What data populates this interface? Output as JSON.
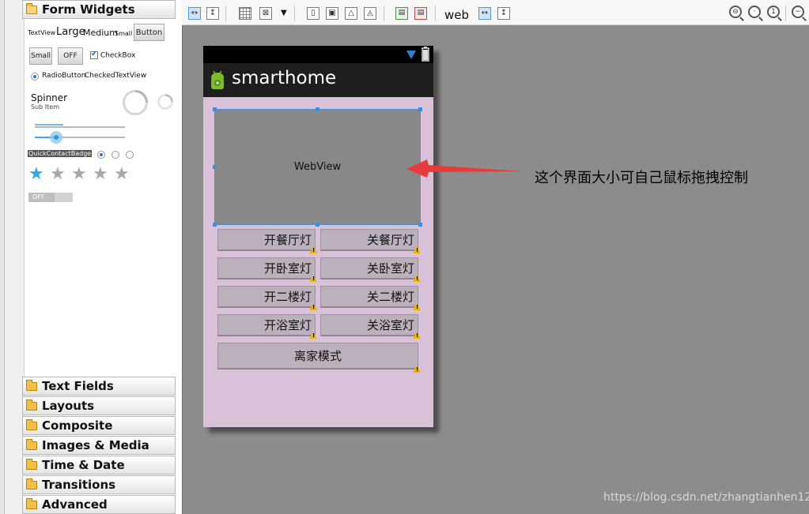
{
  "palette": {
    "form_widgets": "Form Widgets",
    "textview_small_label": "TextView",
    "large_label": "Large",
    "medium_label": "Medium",
    "small_label": "Small",
    "button_label": "Button",
    "small_button_label": "Small",
    "toggle_off_label": "OFF",
    "checkbox_label": "CheckBox",
    "radio_label": "RadioButton",
    "checked_textview_label": "CheckedTextView",
    "spinner_label": "Spinner",
    "sub_item_label": "Sub Item",
    "quick_contact_label": "QuickContactBadge",
    "switch_off_label": "OFF",
    "rating": 1,
    "rating_max": 5,
    "categories": [
      "Text Fields",
      "Layouts",
      "Composite",
      "Images & Media",
      "Time & Date",
      "Transitions",
      "Advanced"
    ]
  },
  "toolbar": {
    "web_label": "web"
  },
  "device": {
    "app_title": "smarthome",
    "webview_label": "WebView",
    "buttons": {
      "r1_left": "开餐厅灯",
      "r1_right": "关餐厅灯",
      "r2_left": "开卧室灯",
      "r2_right": "关卧室灯",
      "r3_left": "开二楼灯",
      "r3_right": "关二楼灯",
      "r4_left": "开浴室灯",
      "r4_right": "关浴室灯",
      "away_mode": "离家模式"
    }
  },
  "annotation": {
    "text": "这个界面大小可自己鼠标拖拽控制",
    "arrow_color": "#e8393b"
  },
  "watermark": "https://blog.csdn.net/zhangtianhen12",
  "colors": {
    "canvas_bg": "#8c8c8c",
    "content_bg": "#d9c1d9",
    "selection": "#3b8ee0"
  }
}
